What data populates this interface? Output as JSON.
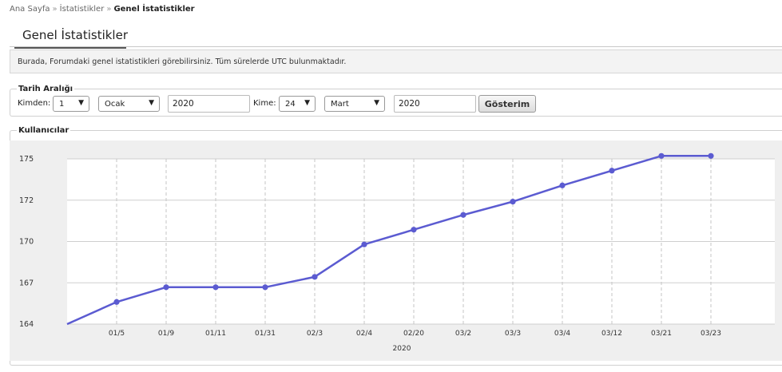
{
  "breadcrumb": {
    "home": "Ana Sayfa",
    "separator": "»",
    "stats": "İstatistikler",
    "current": "Genel İstatistikler"
  },
  "page": {
    "title": "Genel İstatistikler",
    "info": "Burada, Forumdaki genel istatistikleri görebilirsiniz. Tüm sürelerde UTC bulunmaktadır."
  },
  "date_range": {
    "legend": "Tarih Aralığı",
    "from_label": "Kimden:",
    "from_day": "1",
    "from_month": "Ocak",
    "from_year": "2020",
    "to_label": "Kime:",
    "to_day": "24",
    "to_month": "Mart",
    "to_year": "2020",
    "submit_label": "Gösterim",
    "dropdown_arrow": "▼"
  },
  "users_section": {
    "legend": "Kullanıcılar"
  },
  "chart_data": {
    "type": "line",
    "title": "",
    "xlabel": "2020",
    "ylabel": "",
    "categories": [
      "",
      "01/5",
      "01/9",
      "01/11",
      "01/31",
      "02/3",
      "02/4",
      "02/20",
      "03/2",
      "03/3",
      "03/4",
      "03/12",
      "03/21",
      "03/23"
    ],
    "values": [
      164,
      165.5,
      166.5,
      166.5,
      166.5,
      167.2,
      169.4,
      170.4,
      171.4,
      172.3,
      173.4,
      174.4,
      175.4,
      175.4
    ],
    "y_ticks": [
      "164",
      "167",
      "170",
      "172",
      "175"
    ],
    "y_tick_values": [
      164,
      166.8,
      169.6,
      172.4,
      175.2
    ],
    "ylim": [
      164,
      175.2
    ],
    "grid": true,
    "line_color": "#5b5bd1",
    "plot_background": "#ffffff",
    "panel_background": "#efefef"
  }
}
